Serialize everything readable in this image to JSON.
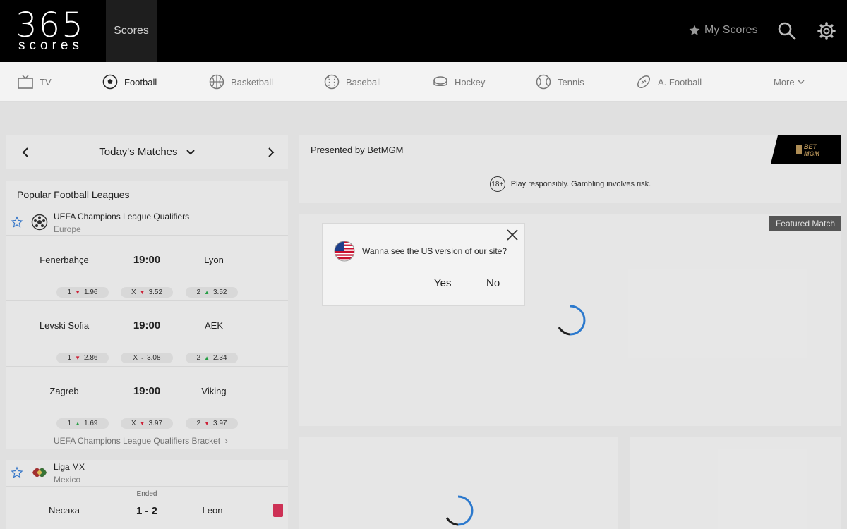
{
  "header": {
    "logo_number": "365",
    "logo_word": "scores",
    "scores_tab": "Scores",
    "my_scores": "My Scores",
    "icons": [
      "star-icon",
      "search-icon",
      "gear-icon"
    ]
  },
  "sports": [
    {
      "label": "TV",
      "icon": "tv-icon"
    },
    {
      "label": "Football",
      "icon": "football-icon"
    },
    {
      "label": "Basketball",
      "icon": "basketball-icon"
    },
    {
      "label": "Baseball",
      "icon": "baseball-icon"
    },
    {
      "label": "Hockey",
      "icon": "hockey-icon"
    },
    {
      "label": "Tennis",
      "icon": "tennis-icon"
    },
    {
      "label": "A. Football",
      "icon": "american-football-icon"
    },
    {
      "label": "More",
      "icon": "chevron-down-icon"
    }
  ],
  "datebar": {
    "title": "Today's Matches"
  },
  "leagues": {
    "title": "Popular Football Leagues",
    "league1": {
      "name": "UEFA Champions League Qualifiers",
      "country": "Europe",
      "matches": [
        {
          "home": "Fenerbahçe",
          "time": "19:00",
          "away": "Lyon",
          "odds": [
            {
              "label": "1",
              "trend": "down",
              "value": "1.96"
            },
            {
              "label": "X",
              "trend": "down",
              "value": "3.52"
            },
            {
              "label": "2",
              "trend": "up",
              "value": "3.52"
            }
          ]
        },
        {
          "home": "Levski Sofia",
          "time": "19:00",
          "away": "AEK",
          "odds": [
            {
              "label": "1",
              "trend": "down",
              "value": "2.86"
            },
            {
              "label": "X",
              "trend": "flat",
              "value": "3.08"
            },
            {
              "label": "2",
              "trend": "up",
              "value": "2.34"
            }
          ]
        },
        {
          "home": "Zagreb",
          "time": "19:00",
          "away": "Viking",
          "odds": [
            {
              "label": "1",
              "trend": "up",
              "value": "1.69"
            },
            {
              "label": "X",
              "trend": "down",
              "value": "3.97"
            },
            {
              "label": "2",
              "trend": "down",
              "value": "3.97"
            }
          ]
        }
      ],
      "bracket": "UEFA Champions League Qualifiers Bracket"
    },
    "league2": {
      "name": "Liga MX",
      "country": "Mexico",
      "match": {
        "status": "Ended",
        "home": "Necaxa",
        "score": "1 - 2",
        "away": "Leon"
      }
    }
  },
  "sponsor": {
    "title": "Presented by BetMGM",
    "logo_text": "BET MGM",
    "badge": "18+",
    "disclaimer": "Play responsibly. Gambling involves risk."
  },
  "featured": {
    "tag": "Featured Match"
  },
  "dialog": {
    "message": "Wanna see the US version of our site?",
    "yes": "Yes",
    "no": "No"
  },
  "colors": {
    "header_bg": "#000000",
    "panel_bg": "#f3f3f3",
    "odd_down": "#d9243b",
    "odd_up": "#2aa84a",
    "red_card": "#d9345a",
    "spinner": "#2f80d8"
  }
}
